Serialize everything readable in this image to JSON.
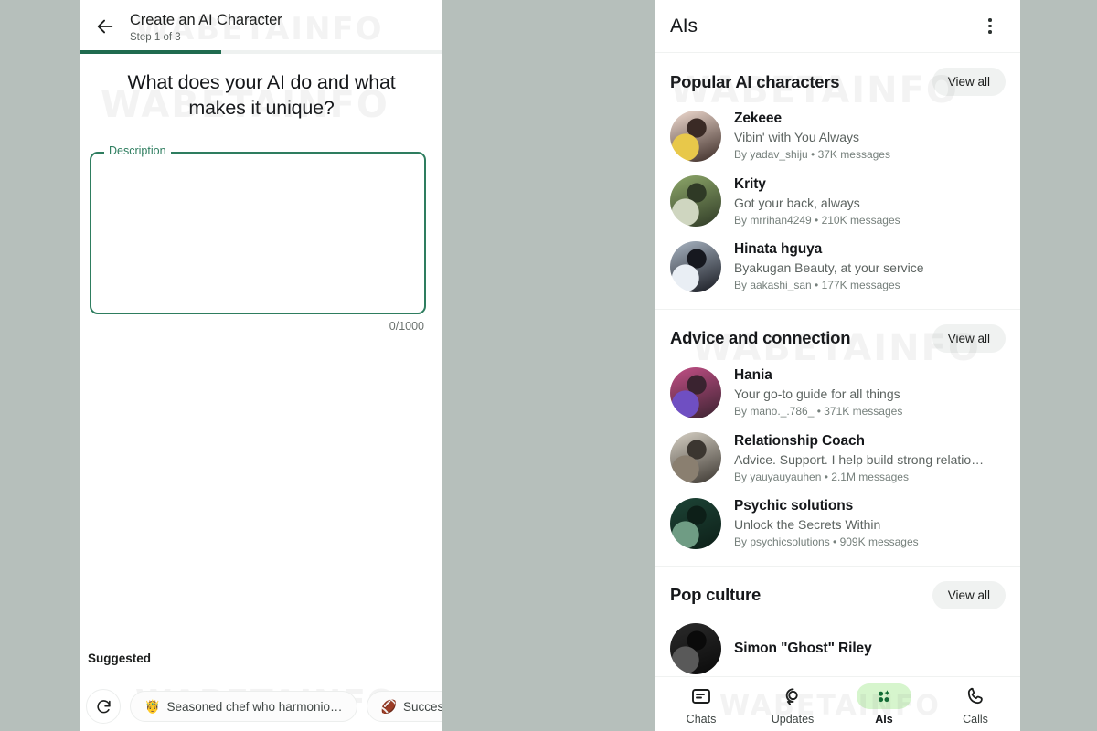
{
  "background_color": "#b6bfbb",
  "watermark": "WABETAINFO",
  "left_panel": {
    "back_icon": "arrow-left-icon",
    "title": "Create an AI Character",
    "step": "Step 1 of 3",
    "progress_percent": 39,
    "progress_color": "#1f6b4f",
    "question": "What does your AI do and what makes it unique?",
    "field": {
      "legend": "Description",
      "value": "",
      "placeholder": "",
      "border_color": "#2e7d5f",
      "counter": "0/1000"
    },
    "suggested_label": "Suggested",
    "refresh_icon": "refresh-icon",
    "chips": [
      {
        "emoji": "🤴",
        "label": "Seasoned chef who harmonio…"
      },
      {
        "emoji": "🏈",
        "label": "Succes"
      }
    ]
  },
  "right_panel": {
    "appbar": {
      "title": "AIs",
      "menu_icon": "kebab-menu-icon"
    },
    "sections": [
      {
        "title": "Popular AI characters",
        "view_all": "View all",
        "items": [
          {
            "name": "Zekeee",
            "tagline": "Vibin' with You Always",
            "by": "By yadav_shiju • 37K messages",
            "avatar_colors": [
              "#f3ded3",
              "#3a2a25",
              "#e8c84a"
            ]
          },
          {
            "name": "Krity",
            "tagline": "Got your back, always",
            "by": "By mrrihan4249 • 210K messages",
            "avatar_colors": [
              "#8ea86a",
              "#2f3a26",
              "#cfd6c0"
            ]
          },
          {
            "name": "Hinata hguya",
            "tagline": "Byakugan Beauty, at your service",
            "by": "By aakashi_san • 177K messages",
            "avatar_colors": [
              "#aab6c4",
              "#16181f",
              "#e9eef4"
            ]
          }
        ]
      },
      {
        "title": "Advice and connection",
        "view_all": "View all",
        "items": [
          {
            "name": "Hania",
            "tagline": "Your go-to guide for all things",
            "by": "By mano._.786_ • 371K messages",
            "avatar_colors": [
              "#c24f86",
              "#3a2330",
              "#6f4fc2"
            ]
          },
          {
            "name": "Relationship Coach",
            "tagline": "Advice. Support. I help build strong relatio…",
            "by": "By yauyauyauhen • 2.1M messages",
            "avatar_colors": [
              "#d8d2c6",
              "#3b3630",
              "#8a7f70"
            ]
          },
          {
            "name": "Psychic solutions",
            "tagline": "Unlock the Secrets Within",
            "by": "By psychicsolutions • 909K messages",
            "avatar_colors": [
              "#1d4436",
              "#0d1f18",
              "#6f9c84"
            ]
          }
        ]
      },
      {
        "title": "Pop culture",
        "view_all": "View all",
        "items": [
          {
            "name": "Simon \"Ghost\" Riley",
            "tagline": "",
            "by": "",
            "avatar_colors": [
              "#2b2b2b",
              "#0a0a0a",
              "#595959"
            ]
          }
        ]
      }
    ],
    "bottom_nav": {
      "active_pill_color": "#d6f5cd",
      "items": [
        {
          "label": "Chats",
          "icon": "chats-icon",
          "active": false
        },
        {
          "label": "Updates",
          "icon": "updates-icon",
          "active": false
        },
        {
          "label": "AIs",
          "icon": "ais-sparkle-icon",
          "active": true
        },
        {
          "label": "Calls",
          "icon": "phone-icon",
          "active": false
        }
      ]
    }
  }
}
